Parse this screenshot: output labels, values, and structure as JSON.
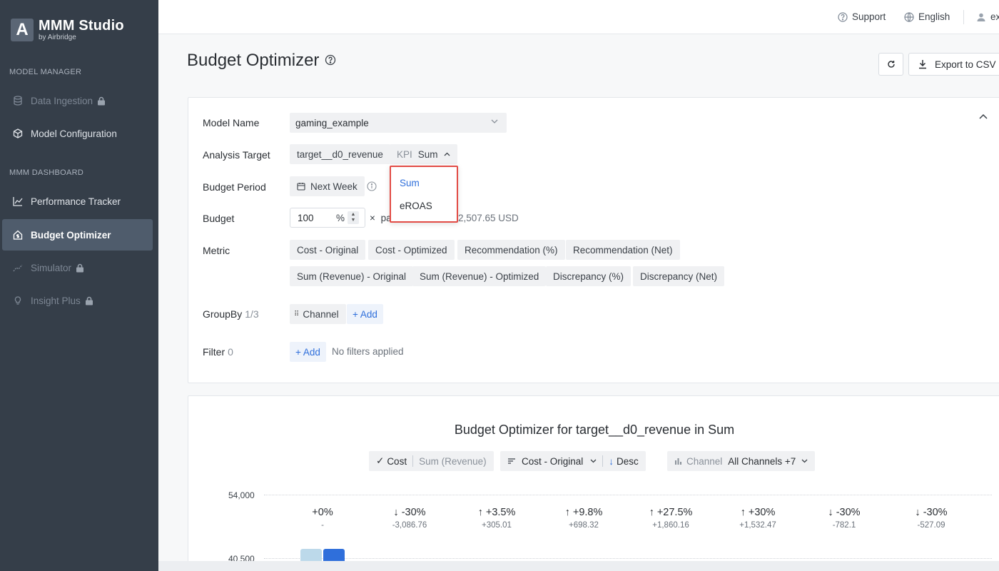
{
  "sidebar": {
    "logo_letter": "A",
    "logo_title": "MMM Studio",
    "logo_subtitle": "by Airbridge",
    "section_model_manager": "MODEL MANAGER",
    "section_dashboard": "MMM DASHBOARD",
    "items": [
      {
        "label": "Data Ingestion",
        "icon": "database-icon",
        "locked": true
      },
      {
        "label": "Model Configuration",
        "icon": "cube-icon",
        "locked": false
      },
      {
        "label": "Performance Tracker",
        "icon": "line-chart-icon",
        "locked": false
      },
      {
        "label": "Budget Optimizer",
        "icon": "house-dollar-icon",
        "locked": false,
        "active": true
      },
      {
        "label": "Simulator",
        "icon": "trend-icon",
        "locked": true
      },
      {
        "label": "Insight Plus",
        "icon": "lightbulb-icon",
        "locked": true
      }
    ]
  },
  "topbar": {
    "support": "Support",
    "language": "English",
    "user": "ex"
  },
  "page": {
    "title": "Budget Optimizer",
    "export_label": "Export to CSV"
  },
  "form": {
    "model_name_label": "Model Name",
    "model_name_value": "gaming_example",
    "analysis_target_label": "Analysis Target",
    "analysis_target_value": "target__d0_revenue",
    "kpi_label": "KPI",
    "kpi_value": "Sum",
    "budget_period_label": "Budget Period",
    "budget_period_value": "Next Week",
    "budget_label": "Budget",
    "budget_value": "100",
    "budget_unit": "%",
    "budget_times": "×",
    "budget_after_text": "pa",
    "budget_usd": "2,507.65 USD",
    "metric_label": "Metric",
    "metrics": [
      "Cost - Original",
      "Cost - Optimized",
      "Recommendation (%)",
      "Recommendation (Net)",
      "Sum (Revenue) - Original",
      "Sum (Revenue) - Optimized",
      "Discrepancy (%)",
      "Discrepancy (Net)"
    ],
    "groupby_label": "GroupBy",
    "groupby_count": "1/3",
    "groupby_chip": "Channel",
    "add_label": "+ Add",
    "filter_label": "Filter",
    "filter_count": "0",
    "no_filters": "No filters applied"
  },
  "kpi_dropdown": {
    "options": [
      "Sum",
      "eROAS"
    ],
    "selected": "Sum"
  },
  "chart_controls": {
    "cost": "Cost",
    "sum_revenue": "Sum (Revenue)",
    "sort_field": "Cost - Original",
    "sort_dir": "Desc",
    "channel_label": "Channel",
    "channel_value": "All Channels +7"
  },
  "chart_data": {
    "type": "bar",
    "title": "Budget Optimizer for target__d0_revenue in Sum",
    "yticks": [
      "54,000",
      "40,500"
    ],
    "annotations": [
      {
        "dir": "",
        "pct": "+0%",
        "val": "-"
      },
      {
        "dir": "down",
        "pct": "-30%",
        "val": "-3,086.76"
      },
      {
        "dir": "up",
        "pct": "+3.5%",
        "val": "+305.01"
      },
      {
        "dir": "up",
        "pct": "+9.8%",
        "val": "+698.32"
      },
      {
        "dir": "up",
        "pct": "+27.5%",
        "val": "+1,860.16"
      },
      {
        "dir": "up",
        "pct": "+30%",
        "val": "+1,532.47"
      },
      {
        "dir": "down",
        "pct": "-30%",
        "val": "-782.1"
      },
      {
        "dir": "down",
        "pct": "-30%",
        "val": "-527.09"
      }
    ],
    "colors": {
      "original": "#bcd9ea",
      "optimized": "#2f6fdb"
    }
  }
}
